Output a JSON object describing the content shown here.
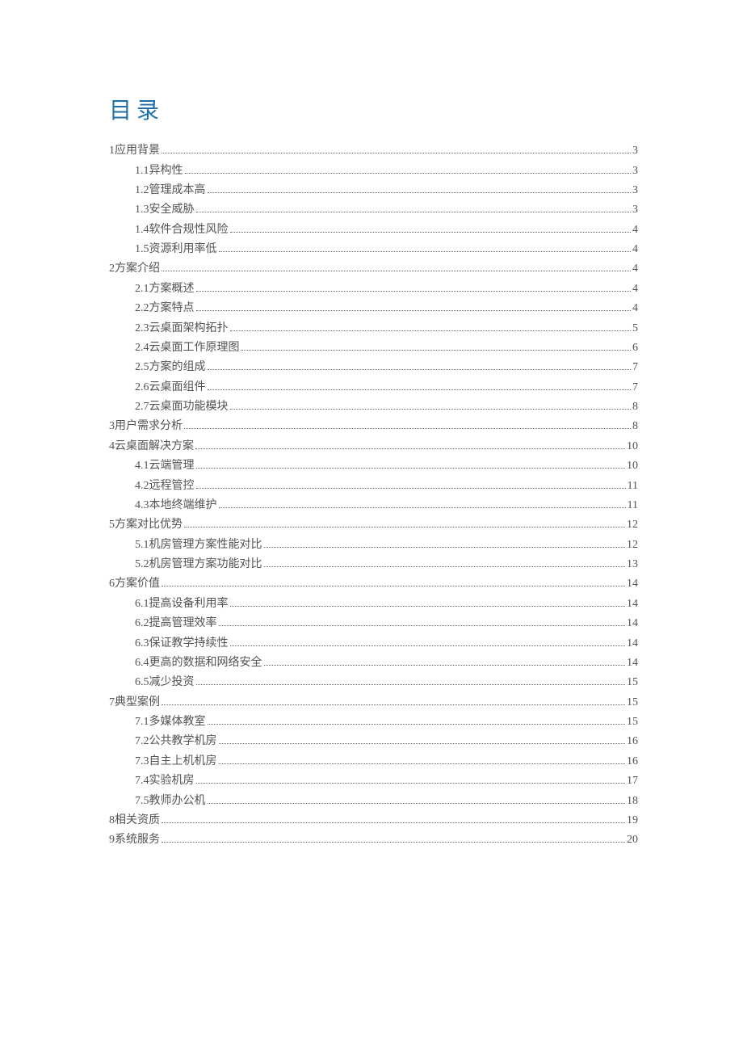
{
  "title": "目录",
  "entries": [
    {
      "level": 1,
      "label": "1应用背景",
      "page": "3"
    },
    {
      "level": 2,
      "label": "1.1异构性",
      "page": "3"
    },
    {
      "level": 2,
      "label": "1.2管理成本高",
      "page": "3"
    },
    {
      "level": 2,
      "label": "1.3安全威胁",
      "page": "3"
    },
    {
      "level": 2,
      "label": "1.4软件合规性风险",
      "page": "4"
    },
    {
      "level": 2,
      "label": "1.5资源利用率低",
      "page": "4"
    },
    {
      "level": 1,
      "label": "2方案介绍",
      "page": "4"
    },
    {
      "level": 2,
      "label": "2.1方案概述",
      "page": "4"
    },
    {
      "level": 2,
      "label": "2.2方案特点",
      "page": "4"
    },
    {
      "level": 2,
      "label": "2.3云桌面架构拓扑",
      "page": "5"
    },
    {
      "level": 2,
      "label": "2.4云桌面工作原理图",
      "page": "6"
    },
    {
      "level": 2,
      "label": "2.5方案的组成",
      "page": "7"
    },
    {
      "level": 2,
      "label": "2.6云桌面组件",
      "page": "7"
    },
    {
      "level": 2,
      "label": "2.7云桌面功能模块",
      "page": "8"
    },
    {
      "level": 1,
      "label": "3用户需求分析",
      "page": "8"
    },
    {
      "level": 1,
      "label": "4云桌面解决方案",
      "page": "10"
    },
    {
      "level": 2,
      "label": "4.1云端管理",
      "page": "10"
    },
    {
      "level": 2,
      "label": "4.2远程管控",
      "page": "11"
    },
    {
      "level": 2,
      "label": "4.3本地终端维护",
      "page": "11"
    },
    {
      "level": 1,
      "label": "5方案对比优势",
      "page": "12"
    },
    {
      "level": 2,
      "label": "5.1机房管理方案性能对比",
      "page": "12"
    },
    {
      "level": 2,
      "label": "5.2机房管理方案功能对比",
      "page": "13"
    },
    {
      "level": 1,
      "label": "6方案价值",
      "page": "14"
    },
    {
      "level": 2,
      "label": "6.1提高设备利用率",
      "page": "14"
    },
    {
      "level": 2,
      "label": "6.2提高管理效率",
      "page": "14"
    },
    {
      "level": 2,
      "label": "6.3保证教学持续性",
      "page": "14"
    },
    {
      "level": 2,
      "label": "6.4更高的数据和网络安全",
      "page": "14"
    },
    {
      "level": 2,
      "label": "6.5减少投资",
      "page": "15"
    },
    {
      "level": 1,
      "label": "7典型案例",
      "page": "15"
    },
    {
      "level": 2,
      "label": "7.1多媒体教室",
      "page": "15"
    },
    {
      "level": 2,
      "label": "7.2公共教学机房",
      "page": "16"
    },
    {
      "level": 2,
      "label": "7.3自主上机机房",
      "page": "16"
    },
    {
      "level": 2,
      "label": "7.4实验机房",
      "page": "17"
    },
    {
      "level": 2,
      "label": "7.5教师办公机",
      "page": "18"
    },
    {
      "level": 1,
      "label": "8相关资质",
      "page": "19"
    },
    {
      "level": 1,
      "label": "9系统服务",
      "page": "20"
    }
  ]
}
